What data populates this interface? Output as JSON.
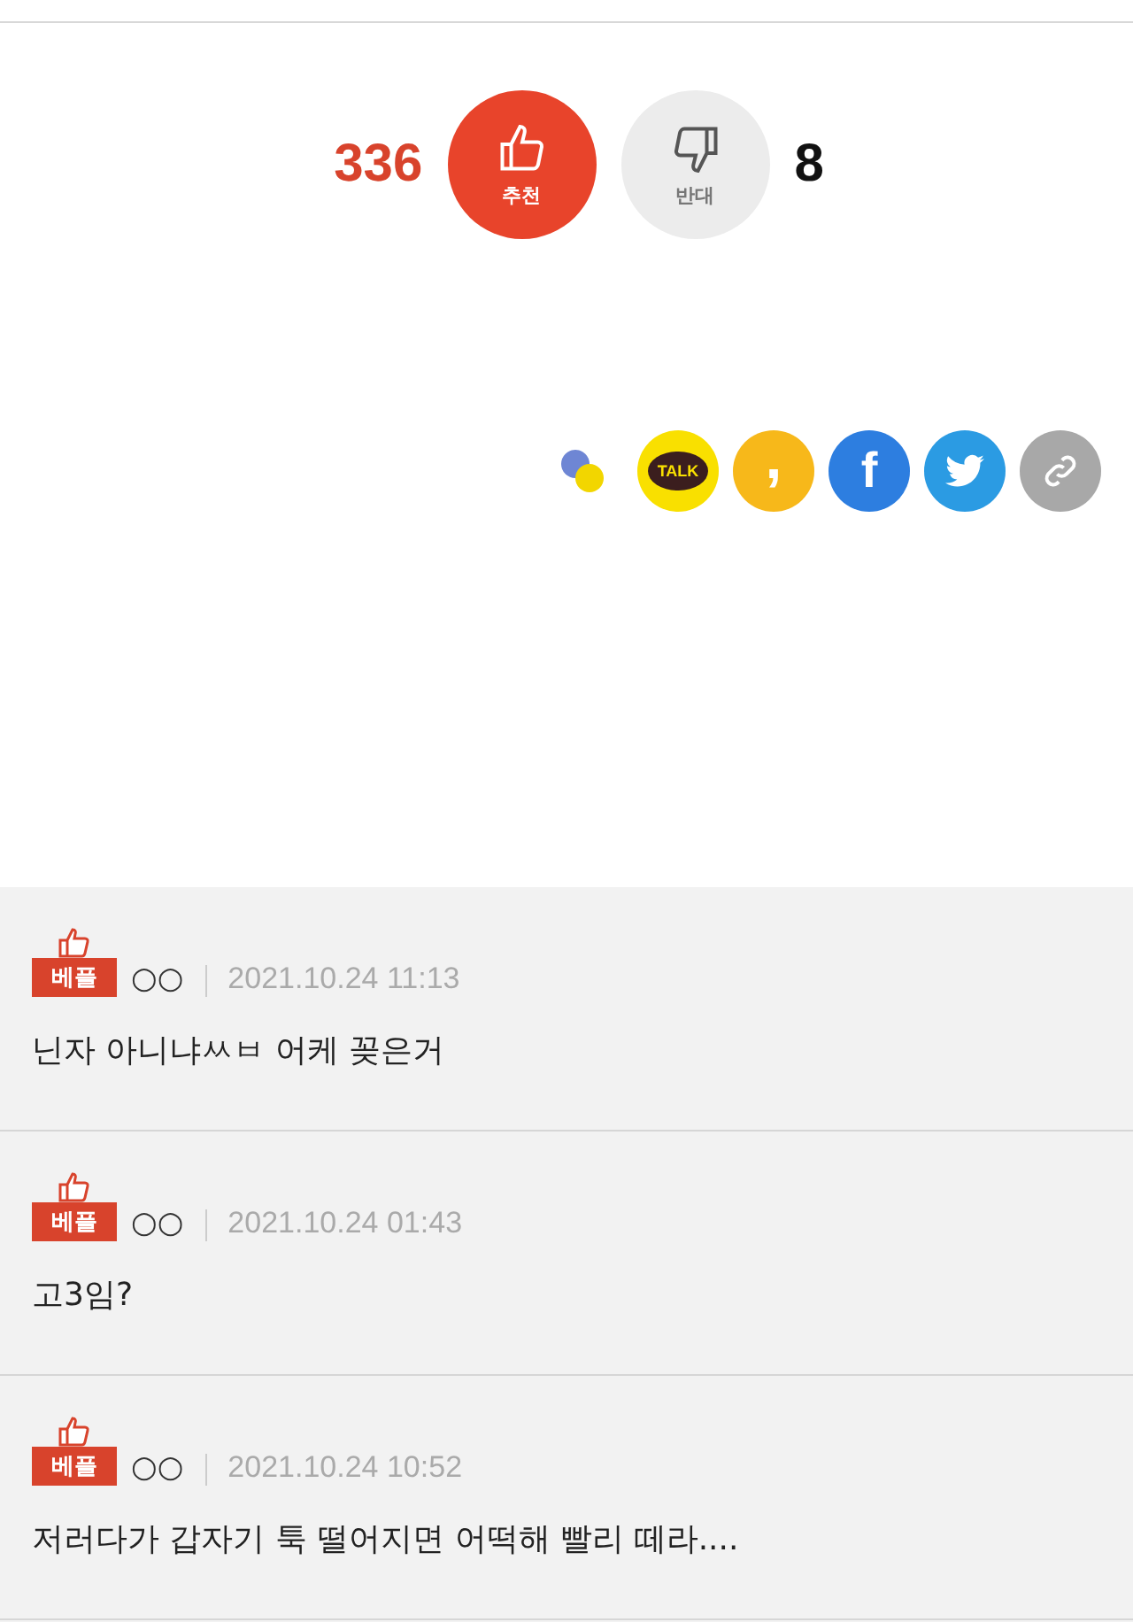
{
  "votes": {
    "up_count": "336",
    "up_label": "추천",
    "down_label": "반대",
    "down_count": "8"
  },
  "share": [
    {
      "kind": "story"
    },
    {
      "kind": "talk",
      "label": "TALK"
    },
    {
      "kind": "comma",
      "label": ","
    },
    {
      "kind": "facebook",
      "label": "f"
    },
    {
      "kind": "twitter"
    },
    {
      "kind": "link"
    }
  ],
  "comments": [
    {
      "badge": "베플",
      "author": "○○",
      "date": "2021.10.24 11:13",
      "text": "닌자 아니냐ㅆㅂ 어케 꽂은거"
    },
    {
      "badge": "베플",
      "author": "○○",
      "date": "2021.10.24 01:43",
      "text": "고3임?"
    },
    {
      "badge": "베플",
      "author": "○○",
      "date": "2021.10.24 10:52",
      "text": "저러다가 갑자기 툭 떨어지면 어떡해 빨리 떼라...."
    }
  ]
}
